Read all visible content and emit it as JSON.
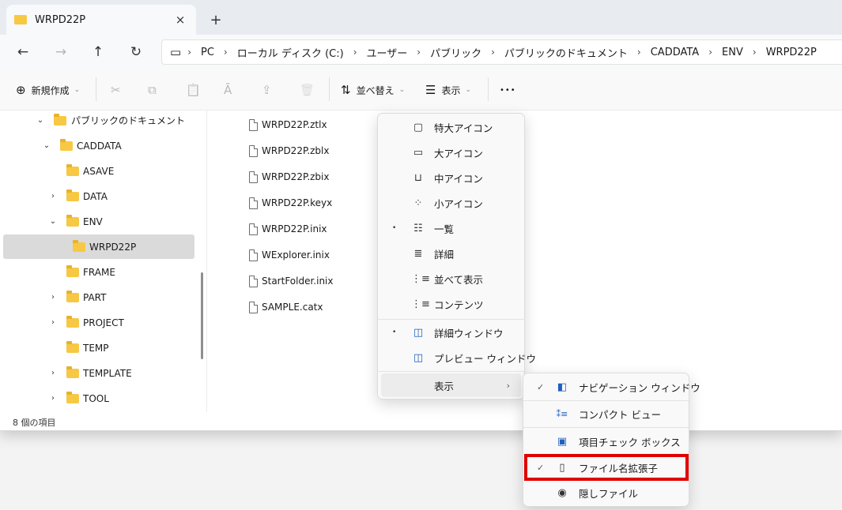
{
  "tab": {
    "title": "WRPD22P",
    "close_icon": "×",
    "new_tab_icon": "+"
  },
  "nav": {
    "back_icon": "←",
    "forward_icon": "→",
    "up_icon": "↑",
    "refresh_icon": "↻",
    "pc_icon": "▭"
  },
  "breadcrumb": [
    "PC",
    "ローカル ディスク (C:)",
    "ユーザー",
    "パブリック",
    "パブリックのドキュメント",
    "CADDATA",
    "ENV",
    "WRPD22P"
  ],
  "breadcrumb_sep": "›",
  "toolbar": {
    "new_label": "新規作成",
    "new_icon": "⊕",
    "cut_icon": "✂",
    "copy_icon": "⧉",
    "paste_icon": "📋",
    "rename_icon": "Ā",
    "share_icon": "⇪",
    "delete_icon": "🗑",
    "sort_label": "並べ替え",
    "sort_icon": "⇅",
    "view_label": "表示",
    "view_icon": "☰",
    "more_icon": "•••",
    "chevron": "⌄"
  },
  "tree": [
    {
      "label": "パブリックのドキュメント",
      "twisty": "⌄"
    },
    {
      "label": "CADDATA",
      "twisty": "⌄"
    },
    {
      "label": "ASAVE",
      "twisty": ""
    },
    {
      "label": "DATA",
      "twisty": "›"
    },
    {
      "label": "ENV",
      "twisty": "⌄"
    },
    {
      "label": "WRPD22P",
      "twisty": ""
    },
    {
      "label": "FRAME",
      "twisty": ""
    },
    {
      "label": "PART",
      "twisty": "›"
    },
    {
      "label": "PROJECT",
      "twisty": "›"
    },
    {
      "label": "TEMP",
      "twisty": ""
    },
    {
      "label": "TEMPLATE",
      "twisty": "›"
    },
    {
      "label": "TOOL",
      "twisty": "›"
    }
  ],
  "files": [
    "WRPD22P.ztlx",
    "WRPD22P.zblx",
    "WRPD22P.zbix",
    "WRPD22P.keyx",
    "WRPD22P.inix",
    "WExplorer.inix",
    "StartFolder.inix",
    "SAMPLE.catx"
  ],
  "status": {
    "count": "8 個の項目"
  },
  "view_menu": {
    "items": [
      {
        "label": "特大アイコン",
        "icon": "▢",
        "bullet": ""
      },
      {
        "label": "大アイコン",
        "icon": "▭",
        "bullet": ""
      },
      {
        "label": "中アイコン",
        "icon": "⊔",
        "bullet": ""
      },
      {
        "label": "小アイコン",
        "icon": "⁘",
        "bullet": ""
      },
      {
        "label": "一覧",
        "icon": "☷",
        "bullet": "•"
      },
      {
        "label": "詳細",
        "icon": "≣",
        "bullet": ""
      },
      {
        "label": "並べて表示",
        "icon": "⋮≡",
        "bullet": ""
      },
      {
        "label": "コンテンツ",
        "icon": "⋮≡",
        "bullet": ""
      }
    ],
    "panes": [
      {
        "label": "詳細ウィンドウ",
        "icon": "◫",
        "bullet": "•"
      },
      {
        "label": "プレビュー ウィンドウ",
        "icon": "◫",
        "bullet": ""
      }
    ],
    "show": {
      "label": "表示",
      "arrow": "›"
    }
  },
  "show_menu": {
    "items": [
      {
        "label": "ナビゲーション ウィンドウ",
        "icon": "◧",
        "check": "✓"
      },
      {
        "label": "コンパクト ビュー",
        "icon": "⁑≡",
        "check": ""
      },
      {
        "label": "項目チェック ボックス",
        "icon": "▣",
        "check": ""
      },
      {
        "label": "ファイル名拡張子",
        "icon": "▯",
        "check": "✓"
      },
      {
        "label": "隠しファイル",
        "icon": "◉",
        "check": ""
      }
    ]
  },
  "colors": {
    "highlight": "#e00000",
    "folder": "#f7c843"
  }
}
